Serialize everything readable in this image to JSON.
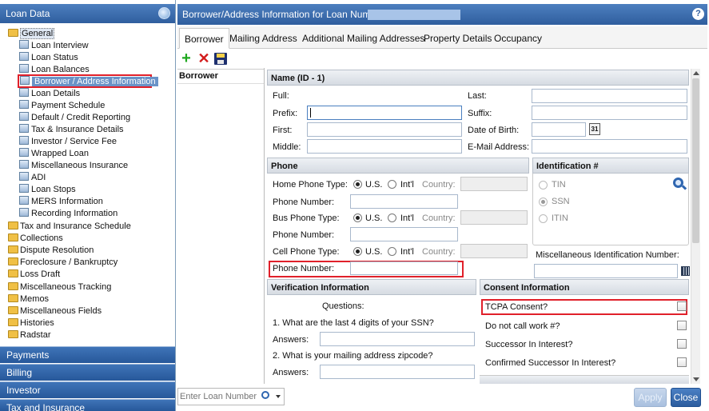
{
  "left": {
    "title": "Loan Data",
    "tree": [
      {
        "label": "General",
        "kind": "folder",
        "level": 0,
        "selected": true
      },
      {
        "label": "Loan Interview",
        "kind": "doc",
        "level": 1
      },
      {
        "label": "Loan Status",
        "kind": "doc",
        "level": 1
      },
      {
        "label": "Loan Balances",
        "kind": "doc",
        "level": 1
      },
      {
        "label": "Borrower / Address Information",
        "kind": "doc",
        "level": 1,
        "highlight": true
      },
      {
        "label": "Loan Details",
        "kind": "doc",
        "level": 1
      },
      {
        "label": "Payment Schedule",
        "kind": "doc",
        "level": 1
      },
      {
        "label": "Default / Credit Reporting",
        "kind": "doc",
        "level": 1
      },
      {
        "label": "Tax & Insurance Details",
        "kind": "doc",
        "level": 1
      },
      {
        "label": "Investor / Service Fee",
        "kind": "doc",
        "level": 1
      },
      {
        "label": "Wrapped Loan",
        "kind": "doc",
        "level": 1
      },
      {
        "label": "Miscellaneous Insurance",
        "kind": "doc",
        "level": 1
      },
      {
        "label": "ADI",
        "kind": "doc",
        "level": 1
      },
      {
        "label": "Loan Stops",
        "kind": "doc",
        "level": 1
      },
      {
        "label": "MERS Information",
        "kind": "doc",
        "level": 1
      },
      {
        "label": "Recording Information",
        "kind": "doc",
        "level": 1
      },
      {
        "label": "Tax and Insurance Schedule",
        "kind": "folder",
        "level": 0
      },
      {
        "label": "Collections",
        "kind": "folder",
        "level": 0
      },
      {
        "label": "Dispute Resolution",
        "kind": "folder",
        "level": 0
      },
      {
        "label": "Foreclosure / Bankruptcy",
        "kind": "folder",
        "level": 0
      },
      {
        "label": "Loss Draft",
        "kind": "folder",
        "level": 0
      },
      {
        "label": "Miscellaneous Tracking",
        "kind": "folder",
        "level": 0
      },
      {
        "label": "Memos",
        "kind": "folder",
        "level": 0
      },
      {
        "label": "Miscellaneous Fields",
        "kind": "folder",
        "level": 0
      },
      {
        "label": "Histories",
        "kind": "folder",
        "level": 0
      },
      {
        "label": "Radstar",
        "kind": "folder",
        "level": 0
      }
    ],
    "sections": [
      "Payments",
      "Billing",
      "Investor",
      "Tax and Insurance"
    ]
  },
  "header": {
    "title": "Borrower/Address Information for Loan Number:"
  },
  "tabs": [
    "Borrower",
    "Mailing Address",
    "Additional Mailing Addresses",
    "Property Details",
    "Occupancy"
  ],
  "subnav": {
    "selected": "Borrower"
  },
  "name_panel": {
    "title": "Name (ID - 1)",
    "full": "Full:",
    "last": "Last:",
    "prefix": "Prefix:",
    "suffix": "Suffix:",
    "first": "First:",
    "dob": "Date of Birth:",
    "middle": "Middle:",
    "email": "E-Mail Address:",
    "calendar_label": "31"
  },
  "phone_panel": {
    "title": "Phone",
    "home_type": "Home Phone Type:",
    "bus_type": "Bus Phone Type:",
    "cell_type": "Cell Phone Type:",
    "phone_number": "Phone Number:",
    "us": "U.S.",
    "intl": "Int'l",
    "country": "Country:"
  },
  "id_panel": {
    "title": "Identification #",
    "tin": "TIN",
    "ssn": "SSN",
    "itin": "ITIN",
    "misc": "Miscellaneous Identification Number:"
  },
  "verification": {
    "title": "Verification Information",
    "questions": "Questions:",
    "q1": "1.   What are the last 4 digits of your SSN?",
    "answers": "Answers:",
    "q2": "2.   What is your mailing address zipcode?"
  },
  "consent": {
    "title": "Consent Information",
    "items": [
      "TCPA Consent?",
      "Do not call work #?",
      "Successor In Interest?",
      "Confirmed Successor In Interest?"
    ]
  },
  "bottom": {
    "placeholder": "Enter Loan Number",
    "apply": "Apply",
    "close": "Close"
  },
  "colors": {
    "accent": "#2f5e9e",
    "highlight": "#e0202a"
  }
}
